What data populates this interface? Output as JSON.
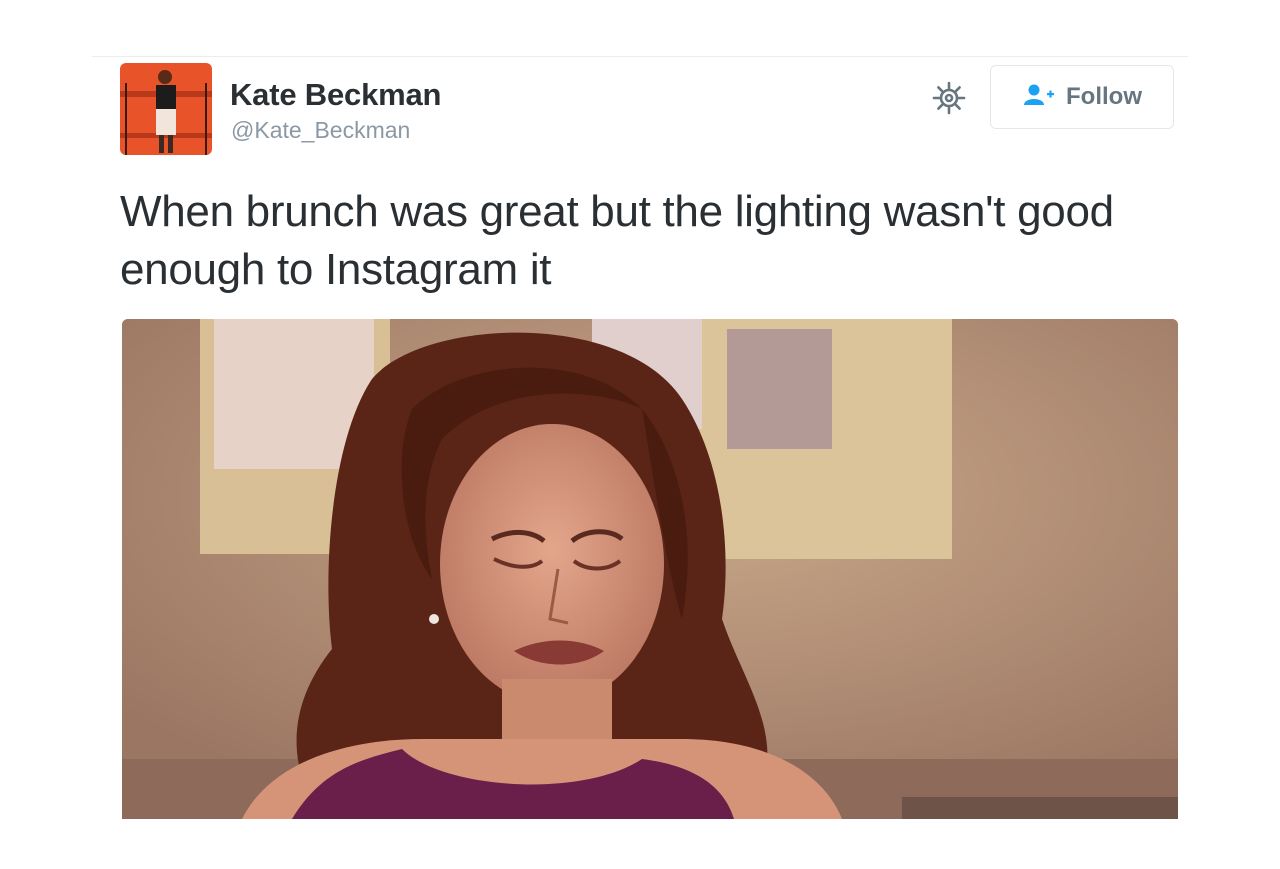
{
  "tweet": {
    "author": {
      "name": "Kate Beckman",
      "handle": "@Kate_Beckman",
      "avatar_icon": "avatar-photo"
    },
    "header": {
      "settings_icon": "gear-icon",
      "follow_icon": "add-user-icon",
      "follow_label": "Follow"
    },
    "text": "When brunch was great but the lighting wasn't good enough to Instagram it",
    "media": {
      "type": "gif-image",
      "description_icon": "crying-woman-gif"
    }
  },
  "colors": {
    "name_text": "#2a2f33",
    "handle_text": "#8b98a5",
    "follow_icon": "#1da1f2",
    "follow_text": "#66757f",
    "avatar_bg": "#e8532a"
  }
}
